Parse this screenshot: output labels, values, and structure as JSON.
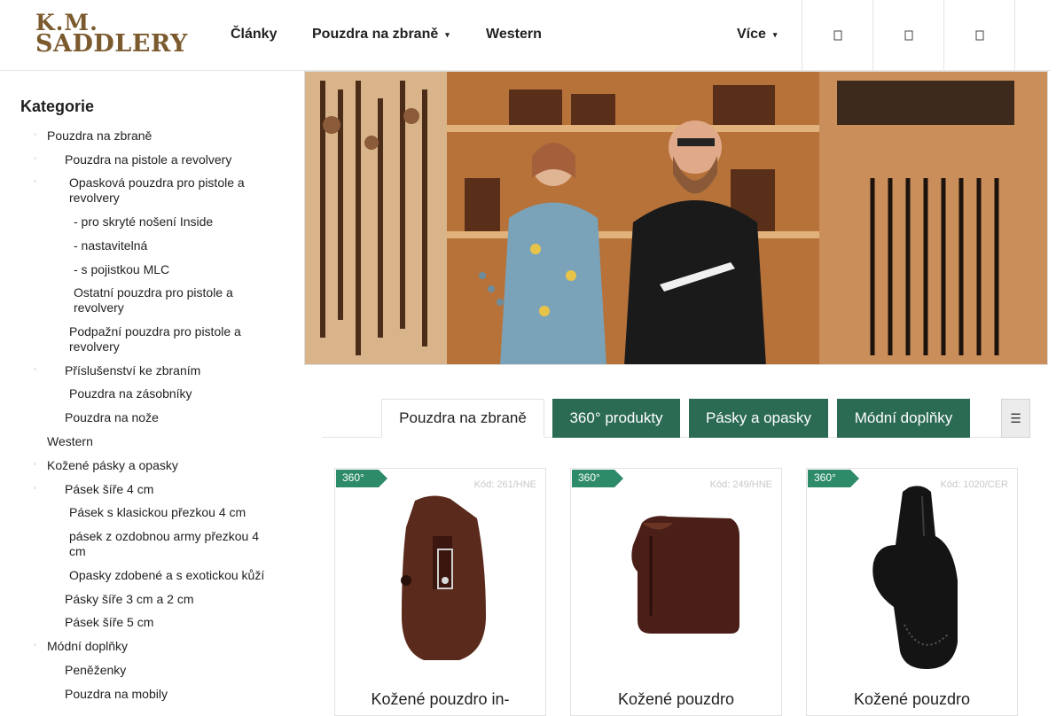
{
  "header": {
    "logo_line1": "K.M.",
    "logo_line2": "SADDLERY",
    "nav": [
      "Články",
      "Pouzdra na zbraně",
      "Western",
      "Více"
    ],
    "icons": [
      "search-icon",
      "user-icon",
      "cart-icon"
    ]
  },
  "sidebar": {
    "title": "Kategorie",
    "items": [
      "Pouzdra na zbraně",
      "Pouzdra na pistole a revolvery",
      "Opasková pouzdra pro pistole a revolvery",
      "- pro skryté nošení Inside",
      "- nastavitelná",
      "- s pojistkou MLC",
      "Ostatní pouzdra pro pistole a revolvery",
      "Podpažní pouzdra pro pistole a revolvery",
      "Příslušenství ke zbraním",
      "Pouzdra na zásobníky",
      "Pouzdra na nože",
      "Western",
      "Kožené pásky a opasky",
      "Pásek šíře 4 cm",
      "Pásek s klasickou přezkou 4 cm",
      "pásek z ozdobnou army přezkou 4 cm",
      "Opasky zdobené a s exotickou kůží",
      "Pásky šíře 3 cm a 2 cm",
      "Pásek šíře 5 cm",
      "Módní doplňky",
      "Peněženky",
      "Pouzdra na mobily"
    ]
  },
  "tabs": {
    "items": [
      "Pouzdra na zbraně",
      "360° produkty",
      "Pásky a opasky",
      "Módní doplňky"
    ],
    "menu_icon": "☰"
  },
  "products": [
    {
      "badge": "360°",
      "code": "Kód: 261/HNE",
      "title": "Kožené pouzdro in-",
      "color": "#5a2a1c"
    },
    {
      "badge": "360°",
      "code": "Kód: 249/HNE",
      "title": "Kožené pouzdro",
      "color": "#4a1f17"
    },
    {
      "badge": "360°",
      "code": "Kód: 1020/CER",
      "title": "Kožené pouzdro",
      "color": "#141414"
    }
  ],
  "colors": {
    "accent": "#2b6b54",
    "badge": "#2e8b6a",
    "logo": "#7b5a2e"
  }
}
